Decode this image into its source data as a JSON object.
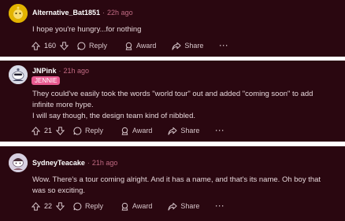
{
  "comments": [
    {
      "username": "Alternative_Bat1851",
      "time": "22h ago",
      "flair": "",
      "body": [
        "I hope you're hungry...for nothing"
      ],
      "votes": "160",
      "reply": "Reply",
      "award": "Award",
      "share": "Share",
      "more": "···",
      "avatar_color": "#e2b300"
    },
    {
      "username": "JNPink",
      "time": "21h ago",
      "flair": "JENNIE",
      "body": [
        "They could've easily took the words \"world tour\" out and added \"coming soon\" to add",
        "infinite more hype.",
        "I will say though, the design team kind of nibbled."
      ],
      "votes": "21",
      "reply": "Reply",
      "award": "Award",
      "share": "Share",
      "more": "···",
      "avatar_color": "#d9dbe7"
    },
    {
      "username": "SydneyTeacake",
      "time": "21h ago",
      "flair": "",
      "body": [
        "Wow. There's a tour coming alright. And it has a name, and that's its name. Oh boy that",
        "was so exciting."
      ],
      "votes": "22",
      "reply": "Reply",
      "award": "Award",
      "share": "Share",
      "more": "···",
      "avatar_color": "#d7cfe0"
    }
  ],
  "colors": {
    "background": "#2a0710",
    "separator": "#ffffff",
    "timestamp": "#c06a82",
    "flair_bg": "#e85a90"
  }
}
